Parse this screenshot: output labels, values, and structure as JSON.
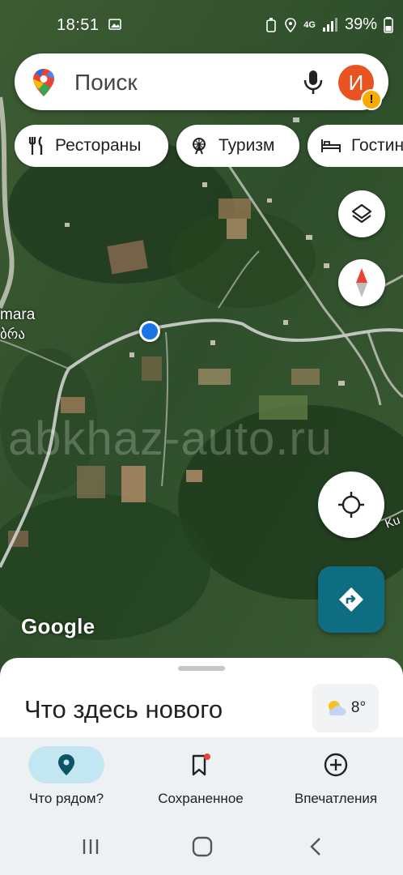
{
  "status_bar": {
    "time": "18:51",
    "network": "4G",
    "battery": "39%"
  },
  "search": {
    "placeholder": "Поиск",
    "avatar_initial": "И"
  },
  "chips": [
    {
      "label": "Рестораны",
      "icon": "fork-knife-icon"
    },
    {
      "label": "Туризм",
      "icon": "ferris-wheel-icon"
    },
    {
      "label": "Гостин",
      "icon": "bed-icon"
    }
  ],
  "map": {
    "place_label_1": "mara",
    "place_label_2": "ბრა",
    "place_label_3": "Ku",
    "watermark": "abkhaz-auto.ru",
    "google_logo": "Google"
  },
  "sheet": {
    "title": "Что здесь нового",
    "temperature": "8°"
  },
  "bottom_nav": [
    {
      "label": "Что рядом?",
      "icon": "location-pin-icon",
      "active": true
    },
    {
      "label": "Сохраненное",
      "icon": "bookmark-icon",
      "active": false
    },
    {
      "label": "Впечатления",
      "icon": "add-circle-icon",
      "active": false
    }
  ],
  "colors": {
    "accent": "#0e6d80",
    "active_tab": "#c3e7f2",
    "avatar": "#e8531f"
  }
}
